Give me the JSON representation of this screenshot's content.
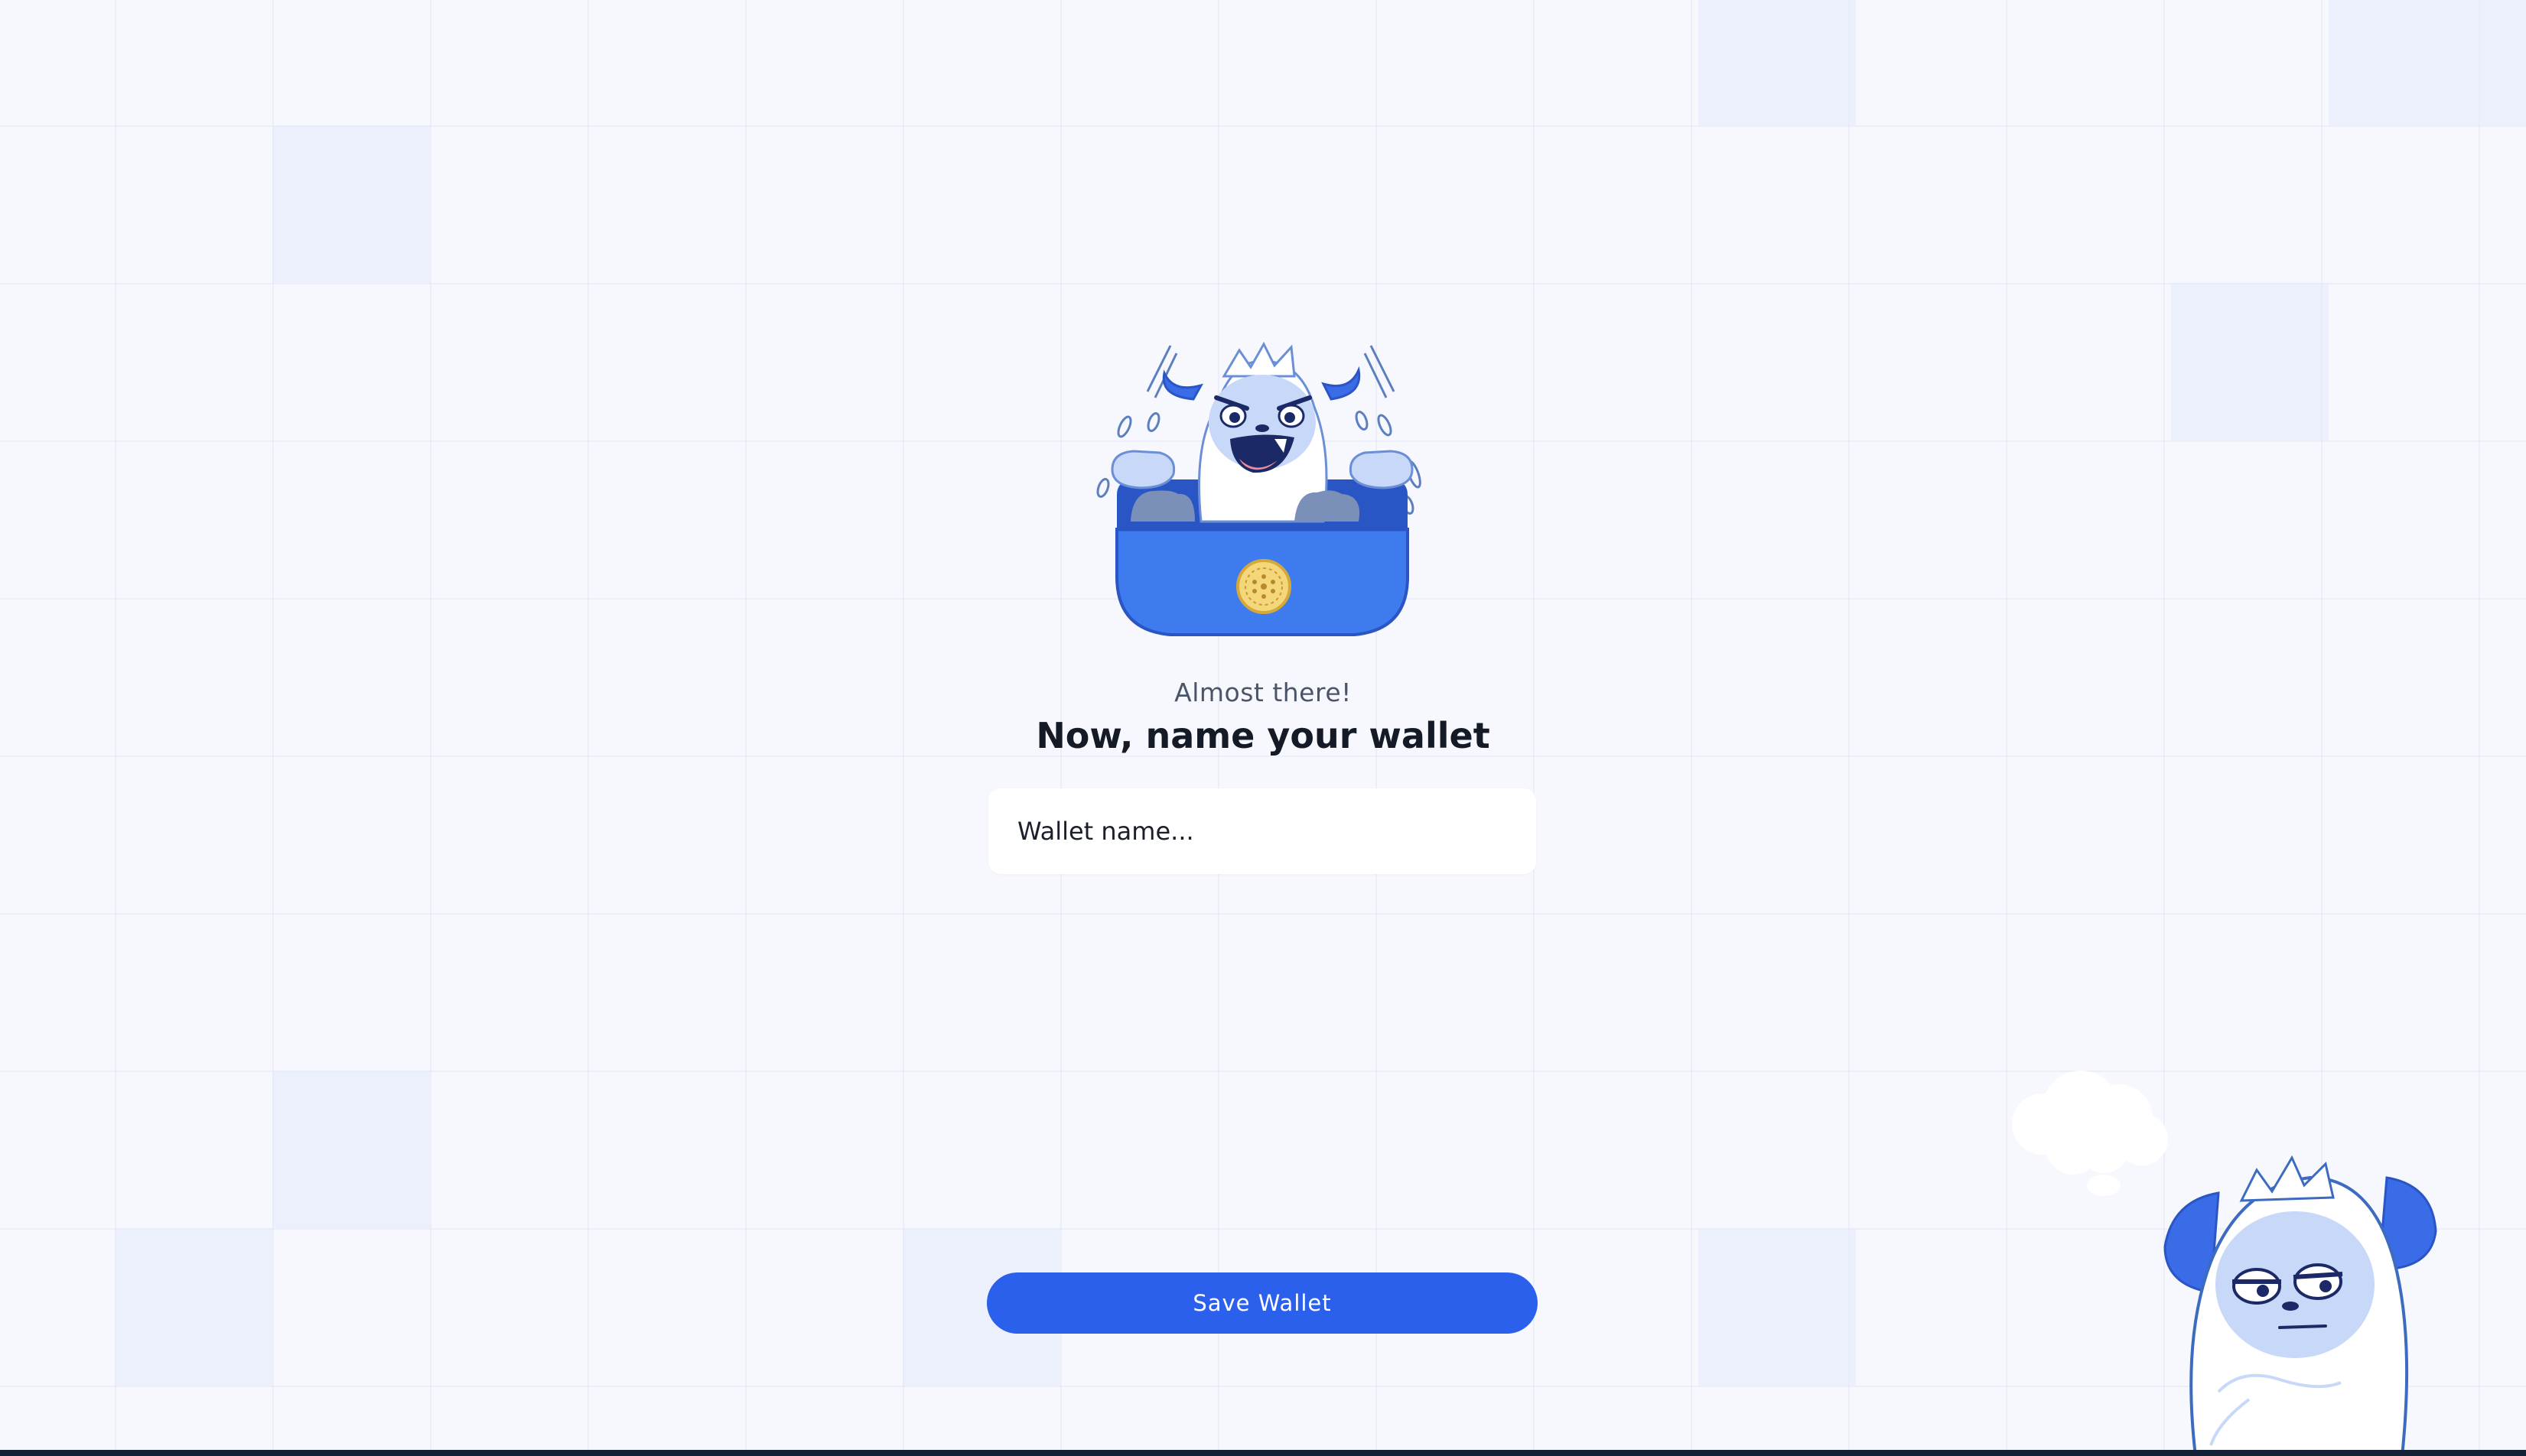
{
  "onboarding": {
    "subtitle": "Almost there!",
    "title": "Now, name your wallet",
    "wallet_name_input": {
      "placeholder": "Wallet name...",
      "value": ""
    },
    "save_button_label": "Save Wallet"
  },
  "illustrations": {
    "hero": "yeti-in-wallet-icon",
    "corner": "thinking-yeti-icon",
    "coin": "coin-icon"
  },
  "colors": {
    "background": "#f7f8fd",
    "accent": "#2a60ec",
    "wallet_blue": "#3d7bef",
    "text_primary": "#141a26",
    "text_secondary": "#4b5568",
    "bottom_strip": "#112035"
  }
}
